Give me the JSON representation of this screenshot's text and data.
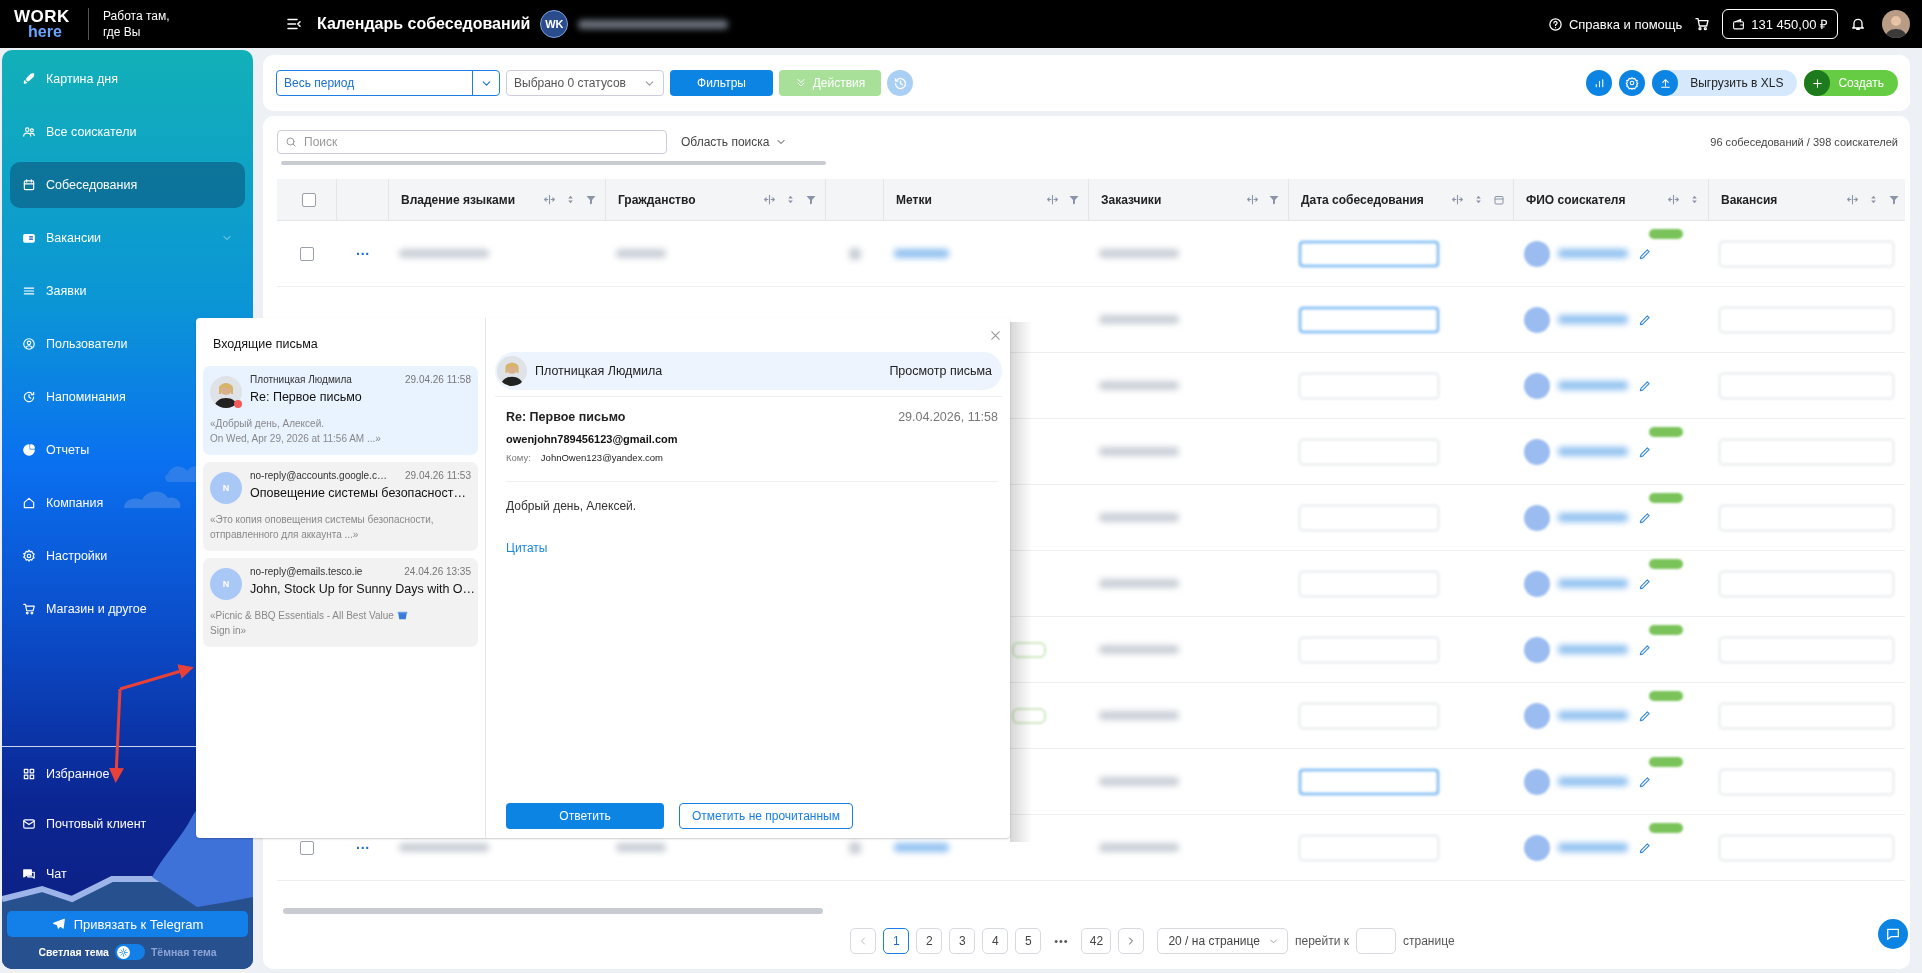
{
  "topbar": {
    "logo_top": "WORK",
    "logo_bottom": "here",
    "tagline": "Работа там, где Вы",
    "title": "Календарь собеседований",
    "account_badge": "WK",
    "help": "Справка и помощь",
    "balance": "131 450,00 ₽"
  },
  "sidebar": {
    "items": [
      {
        "label": "Картина дня",
        "selected": false,
        "has_submenu": false
      },
      {
        "label": "Все соискатели",
        "selected": false,
        "has_submenu": false
      },
      {
        "label": "Собеседования",
        "selected": true,
        "has_submenu": false
      },
      {
        "label": "Вакансии",
        "selected": false,
        "has_submenu": true
      },
      {
        "label": "Заявки",
        "selected": false,
        "has_submenu": false
      },
      {
        "label": "Пользователи",
        "selected": false,
        "has_submenu": false
      },
      {
        "label": "Напоминания",
        "selected": false,
        "has_submenu": false
      },
      {
        "label": "Отчеты",
        "selected": false,
        "has_submenu": false
      },
      {
        "label": "Компания",
        "selected": false,
        "has_submenu": false
      },
      {
        "label": "Настройки",
        "selected": false,
        "has_submenu": false
      },
      {
        "label": "Магазин и другое",
        "selected": false,
        "has_submenu": false
      }
    ],
    "bottom_items": [
      {
        "label": "Избранное",
        "selected": false
      },
      {
        "label": "Почтовый клиент",
        "selected": false
      },
      {
        "label": "Чат",
        "selected": false
      }
    ],
    "telegram_button": "Привязать к Telegram",
    "theme": {
      "light_label": "Светлая тема",
      "dark_label": "Тёмная тема",
      "dark": false
    }
  },
  "toolbar": {
    "period": "Весь период",
    "statuses": "Выбрано 0 статусов",
    "filters_button": "Фильтры",
    "actions_button": {
      "label": "Действия",
      "disabled": true
    },
    "export_button": "Выгрузить в XLS",
    "create_button": "Создать"
  },
  "table": {
    "header_checked": false,
    "search_placeholder": "Поиск",
    "search_scope": "Область поиска",
    "count": "96 собеседований / 398 соискателей",
    "columns": [
      {
        "label": "Владение языками"
      },
      {
        "label": "Гражданство"
      },
      {},
      {
        "label": "Метки"
      },
      {
        "label": "Заказчики"
      },
      {
        "label": "Дата собеседования"
      },
      {
        "label": "ФИО соискателя"
      },
      {
        "label": "Вакансия"
      }
    ],
    "rows": [
      {
        "checked": false,
        "kind": "button",
        "badge": true
      },
      {
        "kind": "button",
        "badge": false
      },
      {
        "kind": "date",
        "badge": false
      },
      {
        "kind": "date",
        "badge": true
      },
      {
        "kind": "date",
        "badge": true
      },
      {
        "kind": "date",
        "badge": true
      },
      {
        "kind": "date",
        "badge": true
      },
      {
        "kind": "date",
        "badge": true
      },
      {
        "kind": "button",
        "badge": true
      },
      {
        "checked": false,
        "kind": "date",
        "badge": true
      }
    ],
    "row_menu": "···"
  },
  "pagination": {
    "pages": [
      {
        "label": "1",
        "selected": true
      },
      {
        "label": "2",
        "selected": false
      },
      {
        "label": "3",
        "selected": false
      },
      {
        "label": "4",
        "selected": false
      },
      {
        "label": "5",
        "selected": false
      }
    ],
    "ellipsis": "•••",
    "last_page": "42",
    "page_size": "20 / на странице",
    "goto_label": "перейти к",
    "goto_suffix": "странице"
  },
  "mail_dialog": {
    "inbox_title": "Входящие письма",
    "messages": [
      {
        "from": "Плотницкая Людмила",
        "date": "29.04.26 11:58",
        "subject": "Re: Первое письмо",
        "preview_lines": [
          "«Добрый день, Алексей.",
          "On Wed, Apr 29, 2026 at 11:56 AM ...»"
        ],
        "kind": "photo",
        "unread": true,
        "emoji": false,
        "selected": true
      },
      {
        "from": "no-reply@accounts.google.c…",
        "date": "29.04.26 11:53",
        "subject": "Оповещение системы безопасност…",
        "preview_lines": [
          "«Это копия оповещения системы безопасности,",
          "отправленного для аккаунта ...»"
        ],
        "kind": "initial",
        "initial": "N",
        "unread": false,
        "emoji": false,
        "selected": false
      },
      {
        "from": "no-reply@emails.tesco.ie",
        "date": "24.04.26 13:35",
        "subject": "John, Stock Up for Sunny Days with O…",
        "preview_lines": [
          "«Picnic & BBQ Essentials - All Best Value",
          "Sign in»"
        ],
        "kind": "initial",
        "initial": "N",
        "unread": false,
        "emoji": true,
        "selected": false
      }
    ],
    "view": {
      "sender": "Плотницкая Людмила",
      "mode": "Просмотр письма",
      "subject": "Re: Первое письмо",
      "date": "29.04.2026, 11:58",
      "from_email": "owenjohn789456123@gmail.com",
      "to_label": "Кому:",
      "to_email": "JohnOwen123@yandex.com",
      "body": "Добрый день, Алексей.",
      "quotes_link": "Цитаты",
      "reply_button": "Ответить",
      "mark_unread_button": "Отметить не прочитанным"
    }
  }
}
